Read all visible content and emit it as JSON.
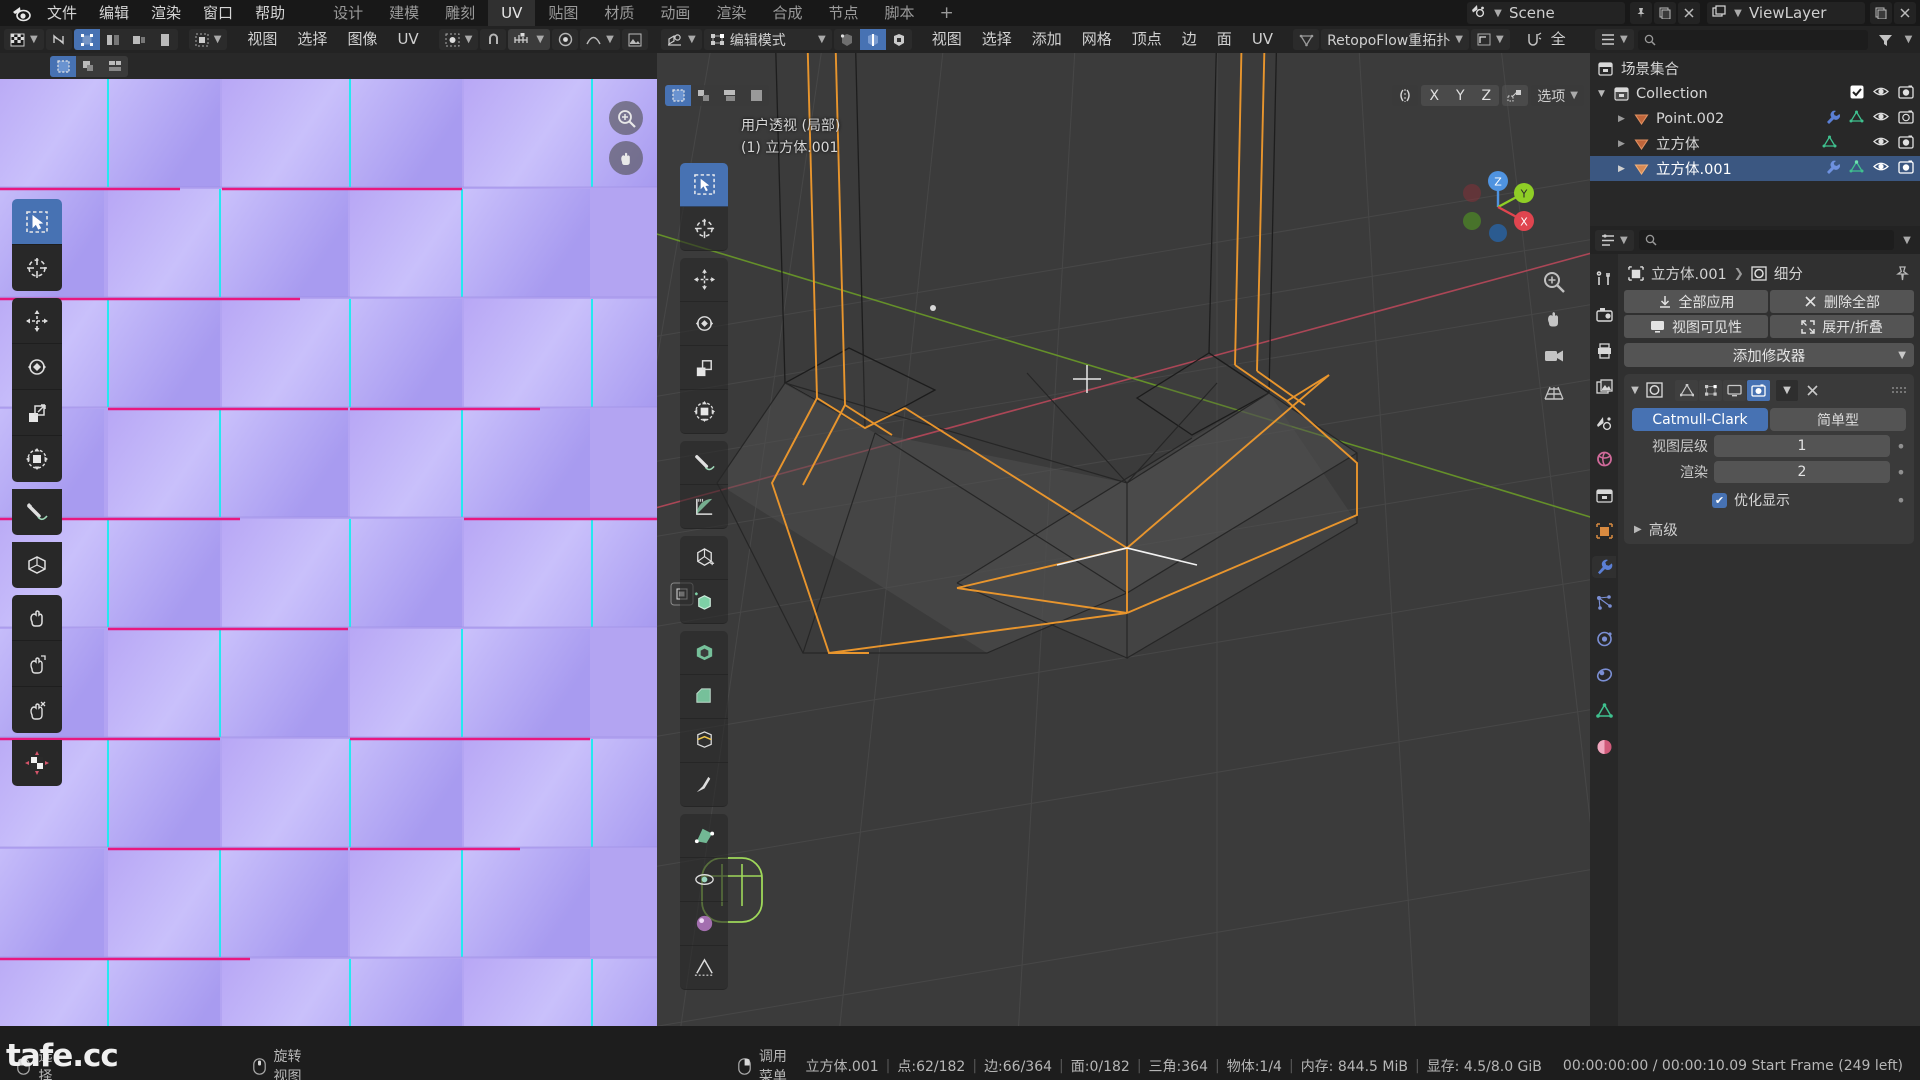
{
  "topbar": {
    "logo_icon": "blender-logo-icon",
    "menus": [
      "文件",
      "编辑",
      "渲染",
      "窗口",
      "帮助"
    ],
    "workspaces": [
      {
        "label": "设计",
        "active": false
      },
      {
        "label": "建模",
        "active": false
      },
      {
        "label": "雕刻",
        "active": false
      },
      {
        "label": "UV",
        "active": true
      },
      {
        "label": "贴图",
        "active": false
      },
      {
        "label": "材质",
        "active": false
      },
      {
        "label": "动画",
        "active": false
      },
      {
        "label": "渲染",
        "active": false
      },
      {
        "label": "合成",
        "active": false
      },
      {
        "label": "节点",
        "active": false
      },
      {
        "label": "脚本",
        "active": false
      }
    ],
    "add_workspace_label": "+",
    "scene_name": "Scene",
    "viewlayer_name": "ViewLayer",
    "scene_icon": "scene-icon",
    "viewlayer_icon": "viewlayer-icon",
    "pin_icon": "pin-icon",
    "new_icon": "new-scene-icon",
    "delete_icon": "delete-scene-icon"
  },
  "uv_editor": {
    "header": {
      "editor_type_icon": "uv-editor-icon",
      "sync_icon": "uv-sync-selection-icon",
      "select_modes": [
        "vertex",
        "edge",
        "face",
        "island"
      ],
      "select_mode_active": 0,
      "sticky_icon": "sticky-selection-icon",
      "menus": [
        "视图",
        "选择",
        "图像",
        "UV"
      ],
      "pivot_icon": "pivot-point-icon",
      "snap_icon": "snap-magnet-icon",
      "snap_to_icon": "snap-increment-icon",
      "proportional_icon": "proportional-edit-icon",
      "falloff_icon": "proportional-falloff-icon",
      "image_icon": "image-browse-icon"
    },
    "subheader": {
      "select_box_icon": "select-box-icon",
      "uv_select_a_icon": "uv-select-overlap-icon",
      "uv_select_b_icon": "uv-select-similar-icon"
    },
    "tools": [
      {
        "name": "tweak-select-box-tool",
        "icon": "select-box-icon",
        "active": true
      },
      {
        "name": "cursor-tool",
        "icon": "cursor-3d-icon",
        "active": false
      },
      {
        "name": "move-tool",
        "icon": "move-arrows-icon",
        "active": false
      },
      {
        "name": "rotate-tool",
        "icon": "rotate-icon",
        "active": false
      },
      {
        "name": "scale-tool",
        "icon": "scale-icon",
        "active": false
      },
      {
        "name": "transform-tool",
        "icon": "transform-icon",
        "active": false
      },
      {
        "name": "annotate-tool",
        "icon": "annotate-pencil-icon",
        "active": false
      },
      {
        "name": "rip-region-tool",
        "icon": "rip-region-icon",
        "active": false
      },
      {
        "name": "grab-tool",
        "icon": "grab-hand-icon",
        "active": false
      },
      {
        "name": "relax-tool",
        "icon": "relax-hand-icon",
        "active": false
      },
      {
        "name": "pinch-tool",
        "icon": "pinch-hand-icon",
        "active": false
      },
      {
        "name": "uv-sculpt-tool",
        "icon": "uv-sculpt-icon",
        "active": true
      }
    ],
    "gizmos": [
      {
        "name": "zoom-gizmo",
        "icon": "zoom-magnifier-icon"
      },
      {
        "name": "pan-gizmo",
        "icon": "pan-hand-icon"
      }
    ]
  },
  "viewport": {
    "header": {
      "editor_type_icon": "3d-viewport-icon",
      "mode_label": "编辑模式",
      "mode_icon": "edit-mode-icon",
      "select_modes": [
        "vertex",
        "edge",
        "face"
      ],
      "select_mode_active": 1,
      "menus": [
        "视图",
        "选择",
        "添加",
        "网格",
        "顶点",
        "边",
        "面",
        "UV"
      ],
      "retopo_label": "RetopoFlow重拓扑",
      "retopo_icon": "retopoflow-icon",
      "transform_orientation_icon": "transform-orientation-icon",
      "snap_icon": "snap-magnet-icon",
      "proportional_icon": "proportional-edit-icon",
      "all_label": "全"
    },
    "overlay_controls": {
      "mirror_icon": "mirror-icon",
      "mirror_axes": [
        "X",
        "Y",
        "Z"
      ],
      "auto_merge_icon": "auto-merge-icon",
      "options_label": "选项"
    },
    "left_overlay": {
      "select_box_icon": "select-box-icon",
      "modes": [
        "a",
        "b",
        "c",
        "d"
      ]
    },
    "info_line1": "用户透视 (局部)",
    "info_line2": "(1) 立方体.001",
    "nav_gizmo": {
      "axes": [
        {
          "label": "Z",
          "color": "#4f93e0"
        },
        {
          "label": "Y",
          "color": "#8fce26"
        },
        {
          "label": "X",
          "color": "#e0454f"
        }
      ]
    },
    "nav_buttons": [
      {
        "name": "zoom-view-gizmo",
        "icon": "zoom-magnifier-icon"
      },
      {
        "name": "pan-view-gizmo",
        "icon": "pan-hand-icon"
      },
      {
        "name": "camera-view-gizmo",
        "icon": "camera-icon"
      },
      {
        "name": "toggle-perspective-gizmo",
        "icon": "grid-perspective-icon"
      }
    ],
    "tools": [
      {
        "name": "tweak-select-box-tool",
        "icon": "select-box-icon",
        "active": true
      },
      {
        "name": "cursor-tool",
        "icon": "cursor-3d-icon",
        "active": false
      },
      {
        "name": "move-tool",
        "icon": "move-arrows-icon",
        "active": false
      },
      {
        "name": "rotate-tool",
        "icon": "rotate-icon",
        "active": false
      },
      {
        "name": "scale-tool",
        "icon": "scale-icon",
        "active": false
      },
      {
        "name": "transform-tool",
        "icon": "transform-icon",
        "active": false
      },
      {
        "name": "annotate-tool",
        "icon": "annotate-pencil-icon",
        "active": false
      },
      {
        "name": "measure-tool",
        "icon": "measure-ruler-icon",
        "active": false
      },
      {
        "name": "add-cube-tool",
        "icon": "add-cube-icon",
        "active": false
      },
      {
        "name": "extrude-region-tool",
        "icon": "extrude-region-icon",
        "active": false
      },
      {
        "name": "inset-faces-tool",
        "icon": "inset-faces-icon",
        "active": false
      },
      {
        "name": "bevel-tool",
        "icon": "bevel-icon",
        "active": false
      },
      {
        "name": "loop-cut-tool",
        "icon": "loop-cut-icon",
        "active": false
      },
      {
        "name": "knife-tool",
        "icon": "knife-icon",
        "active": false
      },
      {
        "name": "poly-build-tool",
        "icon": "poly-build-icon",
        "active": false
      },
      {
        "name": "spin-tool",
        "icon": "spin-icon",
        "active": false
      },
      {
        "name": "smooth-tool",
        "icon": "smooth-icon",
        "active": false
      },
      {
        "name": "edge-slide-tool",
        "icon": "edge-slide-icon",
        "active": false
      },
      {
        "name": "shrink-fatten-tool",
        "icon": "shrink-fatten-icon",
        "active": false
      }
    ]
  },
  "outliner": {
    "display_mode_icon": "outliner-display-mode-icon",
    "filter_icon": "filter-funnel-icon",
    "search_placeholder": "",
    "rows": [
      {
        "indent": 0,
        "disclosure": "",
        "icon": "scene-collection-icon",
        "name": "场景集合",
        "selected": false,
        "icons": [],
        "checkbox": false
      },
      {
        "indent": 1,
        "disclosure": "▼",
        "icon": "collection-icon",
        "name": "Collection",
        "selected": false,
        "icons": [
          "eye-icon",
          "camera-icon"
        ],
        "checkbox": true
      },
      {
        "indent": 2,
        "disclosure": "▶",
        "icon": "mesh-object-icon",
        "name": "Point.002",
        "selected": false,
        "icons": [
          "modifier-wrench-icon",
          "mesh-data-icon",
          "eye-icon",
          "camera-icon"
        ],
        "checkbox": false
      },
      {
        "indent": 2,
        "disclosure": "▶",
        "icon": "mesh-object-icon",
        "name": "立方体",
        "selected": false,
        "icons": [
          "mesh-data-icon",
          "eye-icon",
          "camera-icon"
        ],
        "checkbox": false
      },
      {
        "indent": 2,
        "disclosure": "▶",
        "icon": "mesh-object-icon",
        "name": "立方体.001",
        "selected": true,
        "icons": [
          "modifier-wrench-icon",
          "mesh-data-icon",
          "eye-icon",
          "camera-icon"
        ],
        "checkbox": false
      }
    ]
  },
  "properties": {
    "editor_type_icon": "properties-editor-icon",
    "search_placeholder": "",
    "tabs": [
      {
        "name": "tool",
        "icon": "tool-screwdriver-icon",
        "active": false,
        "color": "#d8d8d8"
      },
      {
        "name": "render",
        "icon": "render-camera-back-icon",
        "active": false,
        "color": "#d8d8d8"
      },
      {
        "name": "output",
        "icon": "output-printer-icon",
        "active": false,
        "color": "#d8d8d8"
      },
      {
        "name": "view-layer",
        "icon": "view-layer-images-icon",
        "active": false,
        "color": "#d8d8d8"
      },
      {
        "name": "scene",
        "icon": "scene-cone-icon",
        "active": false,
        "color": "#d8d8d8"
      },
      {
        "name": "world",
        "icon": "world-globe-icon",
        "active": false,
        "color": "#d06a9a"
      },
      {
        "name": "collection",
        "icon": "collection-box-icon",
        "active": false,
        "color": "#d8d8d8"
      },
      {
        "name": "object",
        "icon": "object-square-icon",
        "active": false,
        "color": "#e0a060"
      },
      {
        "name": "modifiers",
        "icon": "modifier-wrench-icon",
        "active": true,
        "color": "#5b7fd4"
      },
      {
        "name": "particles",
        "icon": "particles-icon",
        "active": false,
        "color": "#7b8fd4"
      },
      {
        "name": "physics",
        "icon": "physics-orbit-icon",
        "active": false,
        "color": "#7b8fd4"
      },
      {
        "name": "constraints",
        "icon": "constraints-icon",
        "active": false,
        "color": "#7b8fd4"
      },
      {
        "name": "data",
        "icon": "mesh-data-icon",
        "active": false,
        "color": "#3fc18f"
      },
      {
        "name": "material",
        "icon": "material-sphere-icon",
        "active": false,
        "color": "#d05a7a"
      }
    ],
    "breadcrumb": {
      "object_icon": "object-square-icon",
      "object_name": "立方体.001",
      "separator": "❯",
      "modifier_icon": "modifier-subsurf-icon",
      "modifier_name": "细分",
      "pin_icon": "pin-icon"
    },
    "actions": [
      {
        "label": "全部应用",
        "icon": "apply-download-icon",
        "name": "apply-all-button"
      },
      {
        "label": "删除全部",
        "icon": "close-x-icon",
        "name": "delete-all-button"
      },
      {
        "label": "视图可见性",
        "icon": "monitor-icon",
        "name": "viewport-visibility-button"
      },
      {
        "label": "展开/折叠",
        "icon": "expand-arrows-icon",
        "name": "expand-collapse-button"
      }
    ],
    "add_modifier_label": "添加修改器",
    "modifier": {
      "expand_icon": "chevron-down-icon",
      "type_icon": "modifier-subsurf-icon",
      "display_toggles": [
        {
          "name": "on-cage-toggle",
          "icon": "on-cage-icon",
          "on": false
        },
        {
          "name": "edit-mode-toggle",
          "icon": "edit-mode-display-icon",
          "on": false
        },
        {
          "name": "realtime-toggle",
          "icon": "monitor-icon",
          "on": false
        },
        {
          "name": "render-toggle",
          "icon": "camera-icon",
          "on": true
        }
      ],
      "menu_icon": "chevron-down-icon",
      "close_icon": "close-x-icon",
      "grip_icon": "drag-grip-icon",
      "algorithm_options": [
        "Catmull-Clark",
        "简单型"
      ],
      "algorithm_active": 0,
      "fields": [
        {
          "label": "视图层级",
          "value": "1",
          "name": "viewport-levels-field"
        },
        {
          "label": "渲染",
          "value": "2",
          "name": "render-levels-field"
        }
      ],
      "checkbox": {
        "label": "优化显示",
        "checked": true,
        "name": "optimal-display-checkbox"
      },
      "advanced_label": "高级",
      "advanced_expanded": false
    }
  },
  "statusbar": {
    "mouse_hints": [
      {
        "icon": "mouse-left-icon",
        "label": "选择"
      },
      {
        "icon": "mouse-middle-icon",
        "label": "旋转视图"
      },
      {
        "icon": "mouse-right-icon",
        "label": "调用菜单"
      }
    ],
    "stats": [
      "立方体.001",
      "点:62/182",
      "边:66/364",
      "面:0/182",
      "三角:364",
      "物体:1/4",
      "内存: 844.5 MiB",
      "显存: 4.5/8.0 GiB"
    ],
    "time_info": "00:00:00:00 / 00:00:10.09 Start Frame (249 left)"
  },
  "watermark": "tafe.cc",
  "colors": {
    "accent_blue": "#4772b3",
    "selection_orange": "#e8952d",
    "axis_x": "#e0454f",
    "axis_y": "#8fce26",
    "axis_z": "#4f93e0",
    "bg_dark": "#1d1d1d",
    "bg_panel": "#303030",
    "bg_header": "#232323"
  }
}
